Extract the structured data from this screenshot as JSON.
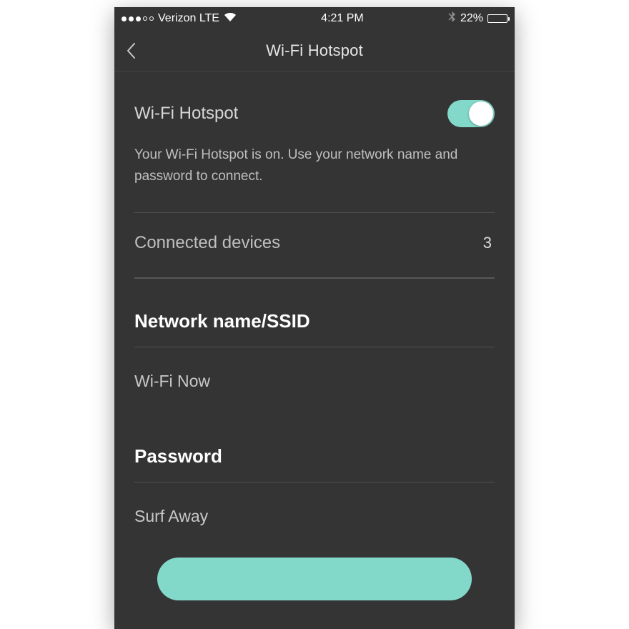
{
  "statusbar": {
    "carrier": "Verizon LTE",
    "time": "4:21 PM",
    "battery_percent": "22%"
  },
  "nav": {
    "title": "Wi-Fi Hotspot"
  },
  "hotspot": {
    "label": "Wi-Fi Hotspot",
    "enabled": true,
    "description": "Your Wi-Fi Hotspot is on.  Use your network name and password to connect."
  },
  "connected": {
    "label": "Connected devices",
    "count": "3"
  },
  "network": {
    "header": "Network name/SSID",
    "value": "Wi-Fi Now"
  },
  "password": {
    "header": "Password",
    "value": "Surf Away"
  }
}
